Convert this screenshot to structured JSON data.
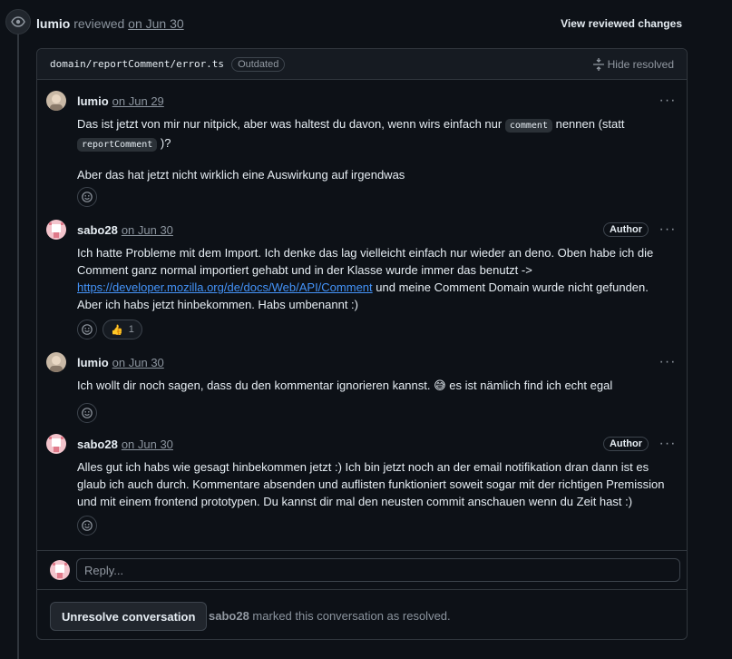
{
  "review": {
    "reviewer": "lumio",
    "action": "reviewed",
    "date": "on Jun 30",
    "view_changes": "View reviewed changes"
  },
  "file": {
    "path": "domain/reportComment/error.ts",
    "badge": "Outdated",
    "hide_resolved": "Hide resolved"
  },
  "comments": [
    {
      "author": "lumio",
      "date": "on Jun 29",
      "p1_a": "Das ist jetzt von mir nur nitpick, aber was haltest du davon, wenn wirs einfach nur ",
      "p1_code1": "comment",
      "p1_b": " nennen (statt ",
      "p1_code2": "reportComment",
      "p1_c": " )?",
      "p2": "Aber das hat jetzt nicht wirklich eine Auswirkung auf irgendwas"
    },
    {
      "author": "sabo28",
      "date": "on Jun 30",
      "badge": "Author",
      "text_a": "Ich hatte Probleme mit dem Import. Ich denke das lag vielleicht einfach nur wieder an deno. Oben habe ich die Comment ganz normal importiert gehabt und in der Klasse wurde immer das benutzt -> ",
      "link": "https://developer.mozilla.org/de/docs/Web/API/Comment",
      "text_b": " und meine Comment Domain wurde nicht gefunden. Aber ich habs jetzt hinbekommen. Habs umbenannt :)",
      "reaction_count": "1"
    },
    {
      "author": "lumio",
      "date": "on Jun 30",
      "text_a": "Ich wollt dir noch sagen, dass du den kommentar ignorieren kannst. ",
      "emoji": "😅",
      "text_b": " es ist nämlich find ich echt egal"
    },
    {
      "author": "sabo28",
      "date": "on Jun 30",
      "badge": "Author",
      "text": "Alles gut ich habs wie gesagt hinbekommen jetzt :) Ich bin jetzt noch an der email notifikation dran dann ist es glaub ich auch durch. Kommentare absenden und auflisten funktioniert soweit sogar mit der richtigen Premission und mit einem frontend prototypen. Du kannst dir mal den neusten commit anschauen wenn du Zeit hast :)"
    }
  ],
  "reply": {
    "placeholder": "Reply..."
  },
  "footer": {
    "unresolve_label": "Unresolve conversation",
    "resolver": "sabo28",
    "resolved_text": " marked this conversation as resolved."
  },
  "colors": {
    "bg": "#0d1117",
    "border": "#30363d",
    "link": "#4493f8",
    "muted": "#8b949e"
  }
}
